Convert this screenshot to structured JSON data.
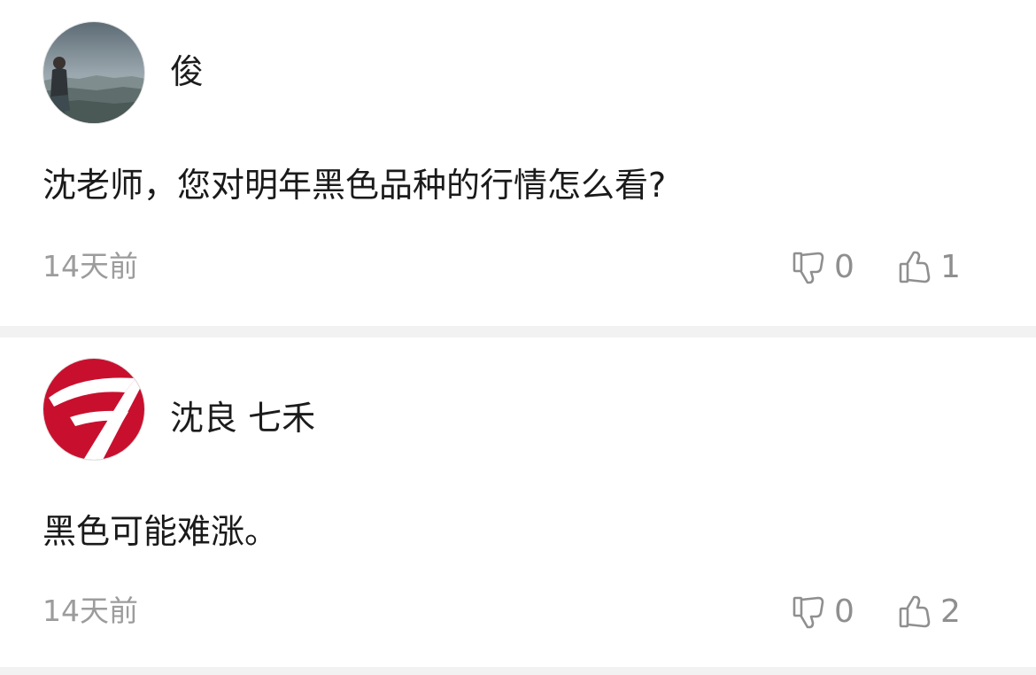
{
  "comments": [
    {
      "username": "俊",
      "avatar": "avatar-photo",
      "text": "沈老师，您对明年黑色品种的行情怎么看?",
      "time": "14天前",
      "dislikes": "0",
      "likes": "1"
    },
    {
      "username": "沈良 七禾",
      "avatar": "avatar-logo-7",
      "text": "黑色可能难涨。",
      "time": "14天前",
      "dislikes": "0",
      "likes": "2"
    }
  ],
  "icons": {
    "dislike": "thumbs-down-icon",
    "like": "thumbs-up-icon"
  },
  "colors": {
    "logo_red": "#c8102e",
    "meta_gray": "#9c9c9c",
    "divider": "#f2f2f2"
  }
}
